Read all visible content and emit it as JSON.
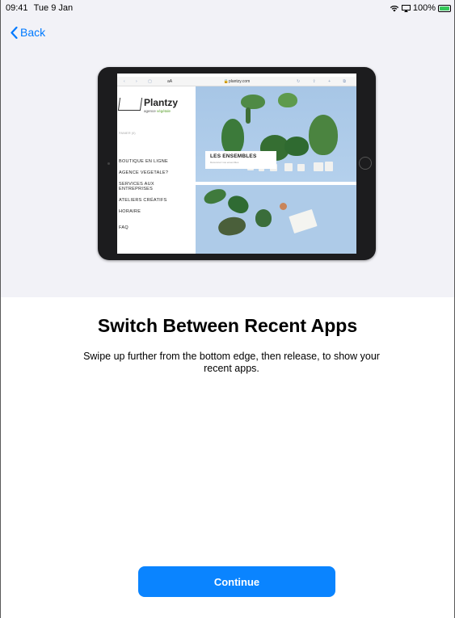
{
  "status_bar": {
    "time": "09:41",
    "date": "Tue 9 Jan",
    "battery": "100%",
    "battery_color": "#34c759",
    "icons": [
      "wifi-icon",
      "screen-mirroring-icon",
      "battery-icon"
    ]
  },
  "nav": {
    "back_label": "Back",
    "accent_color": "#007aff"
  },
  "illustration": {
    "url": "plantzy.com",
    "url_prefix": "aA",
    "brand": "Plantzy",
    "tagline_prefix": "agence",
    "tagline_highlight": "végétale",
    "small_text": "PANIER (0)",
    "menu": [
      "BOUTIQUE EN LIGNE",
      "AGENCE VEGETALE?",
      "SERVICES AUX ENTREPRISES",
      "ATELIERS CRÉATIFS",
      "HORAIRE",
      "FAQ"
    ],
    "card_title": "LES ENSEMBLES",
    "card_subtitle": "Découvrez nos ensembles"
  },
  "content": {
    "title": "Switch Between Recent Apps",
    "description": "Swipe up further from the bottom edge, then release, to show your recent apps."
  },
  "actions": {
    "continue_label": "Continue",
    "button_color": "#0a84ff"
  }
}
